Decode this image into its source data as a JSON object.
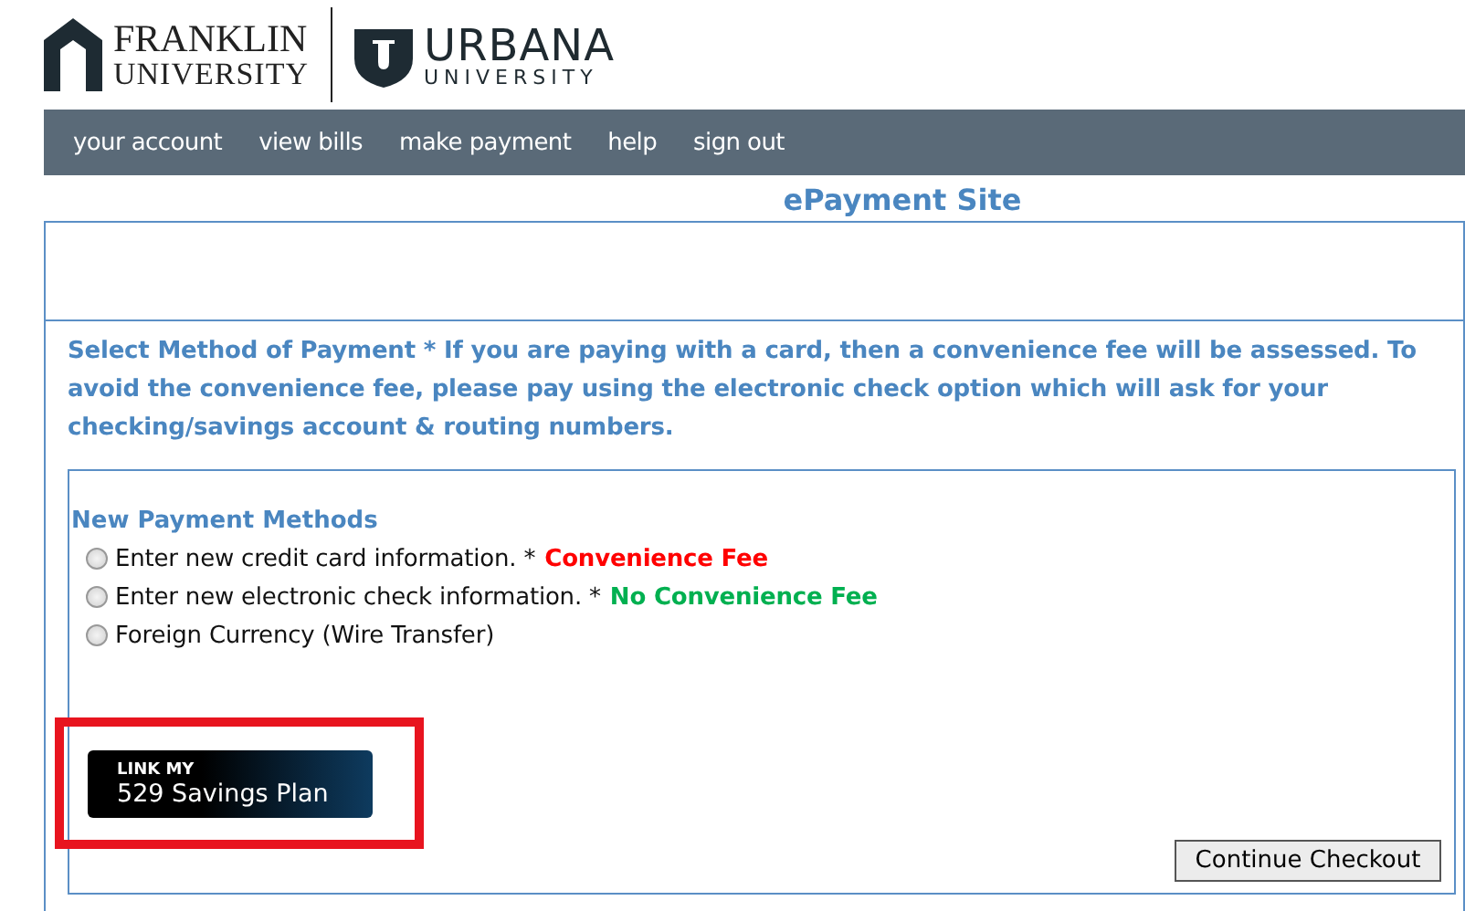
{
  "logos": [
    {
      "kind": "franklin",
      "line1": "FRANKLIN",
      "line2": "UNIVERSITY"
    },
    {
      "kind": "urbana",
      "line1": "URBANA",
      "line2": "UNIVERSITY"
    }
  ],
  "nav": [
    "your account",
    "view bills",
    "make payment",
    "help",
    "sign out"
  ],
  "title": "ePayment Site",
  "instructions": "Select Method of Payment * If you are paying with a card, then a convenience fee will be assessed.  To avoid the convenience fee, please pay using the electronic check option which will ask for your checking/savings account & routing numbers.",
  "methods": {
    "heading": "New Payment Methods",
    "options": [
      {
        "label": "Enter new credit card information. *",
        "fee": "Convenience Fee",
        "color": "#ff0000",
        "selected": false
      },
      {
        "label": "Enter new electronic check information. *",
        "fee": "No Convenience Fee",
        "color": "#00b050",
        "selected": false
      },
      {
        "label": "Foreign Currency (Wire Transfer)",
        "selected": false
      }
    ]
  },
  "link_button": {
    "line1": "LINK MY",
    "line2": "529 Savings Plan",
    "highlighted": true
  },
  "continue_button": "Continue Checkout"
}
